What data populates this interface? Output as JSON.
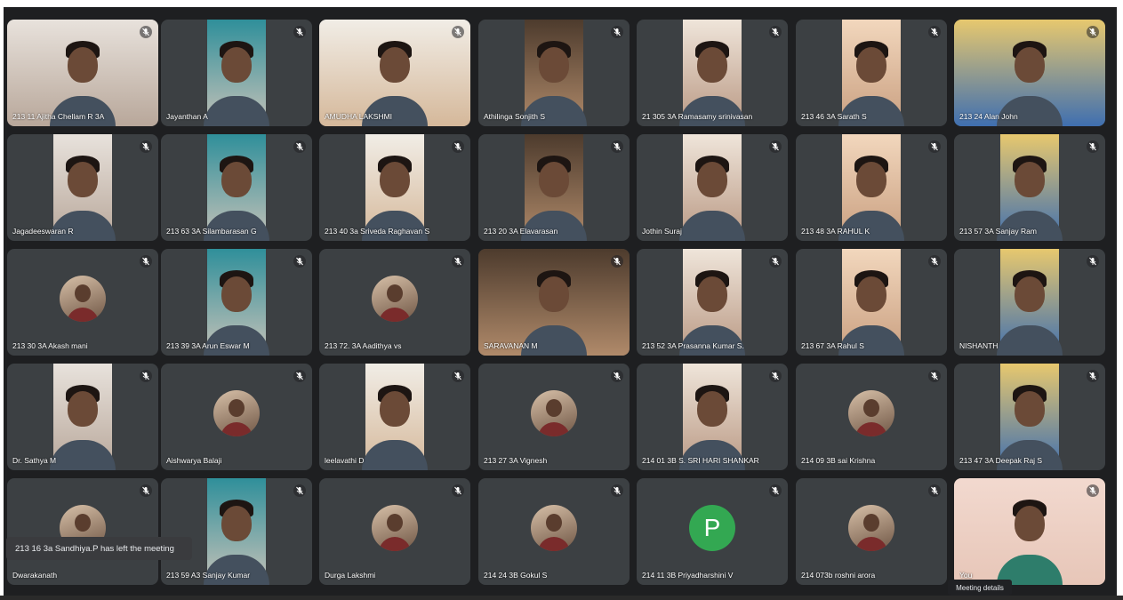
{
  "participants": [
    {
      "name": "213 11 Ajitha Chellam R 3A",
      "video": true
    },
    {
      "name": "Jayanthan A",
      "video": true
    },
    {
      "name": "AMUDHA LAKSHMI",
      "video": true
    },
    {
      "name": "Athilinga Sonjith S",
      "video": true
    },
    {
      "name": "21 305 3A Ramasamy srinivasan",
      "video": true
    },
    {
      "name": "213 46 3A Sarath S",
      "video": true
    },
    {
      "name": "213 24 Alan John",
      "video": true
    },
    {
      "name": "Jagadeeswaran R",
      "video": true
    },
    {
      "name": "213 63 3A Silambarasan G",
      "video": true
    },
    {
      "name": "213 40 3a Sriveda Raghavan S",
      "video": true
    },
    {
      "name": "213 20 3A Elavarasan",
      "video": true
    },
    {
      "name": "Jothin Suraj",
      "video": true
    },
    {
      "name": "213 48 3A RAHUL K",
      "video": true
    },
    {
      "name": "213 57 3A Sanjay Ram",
      "video": true
    },
    {
      "name": "213 30 3A Akash mani",
      "video": false,
      "avatar": "photo"
    },
    {
      "name": "213 39 3A Arun Eswar M",
      "video": true
    },
    {
      "name": "213 72. 3A Aadithya vs",
      "video": false,
      "avatar": "photo"
    },
    {
      "name": "SARAVANAN M",
      "video": true
    },
    {
      "name": "213 52 3A Prasanna Kumar S.",
      "video": true
    },
    {
      "name": "213 67 3A Rahul S",
      "video": true
    },
    {
      "name": "NISHANTH",
      "video": true
    },
    {
      "name": "Dr. Sathya M",
      "video": true
    },
    {
      "name": "Aishwarya Balaji",
      "video": false,
      "avatar": "photo"
    },
    {
      "name": "leelavathi D",
      "video": true
    },
    {
      "name": "213 27 3A Vignesh",
      "video": false,
      "avatar": "photo"
    },
    {
      "name": "214 01 3B S. SRI HARI SHANKAR",
      "video": true
    },
    {
      "name": "214 09 3B sai Krishna",
      "video": false,
      "avatar": "photo"
    },
    {
      "name": "213 47 3A Deepak Raj S",
      "video": true
    },
    {
      "name": "Dwarakanath",
      "video": false,
      "avatar": "photo"
    },
    {
      "name": "213 59 A3 Sanjay Kumar",
      "video": true
    },
    {
      "name": "Durga Lakshmi",
      "video": false,
      "avatar": "photo"
    },
    {
      "name": "214 24 3B Gokul S",
      "video": false,
      "avatar": "photo"
    },
    {
      "name": "214 11 3B Priyadharshini V",
      "video": false,
      "avatar": "letter",
      "letter": "P",
      "avatar_color": "#33a852"
    },
    {
      "name": "214 073b roshni arora",
      "video": false,
      "avatar": "photo"
    },
    {
      "name": "You",
      "video": true,
      "self": true
    }
  ],
  "toast": {
    "text": "213 16 3a Sandhiya.P has left the meeting"
  },
  "meeting_details": {
    "label": "Meeting details"
  },
  "colors": {
    "tile_bg": "#3c4043",
    "frame_bg": "#1e1f21",
    "avatar_green": "#33a852"
  },
  "icons": {
    "mic_state": "mic-off-icon"
  }
}
